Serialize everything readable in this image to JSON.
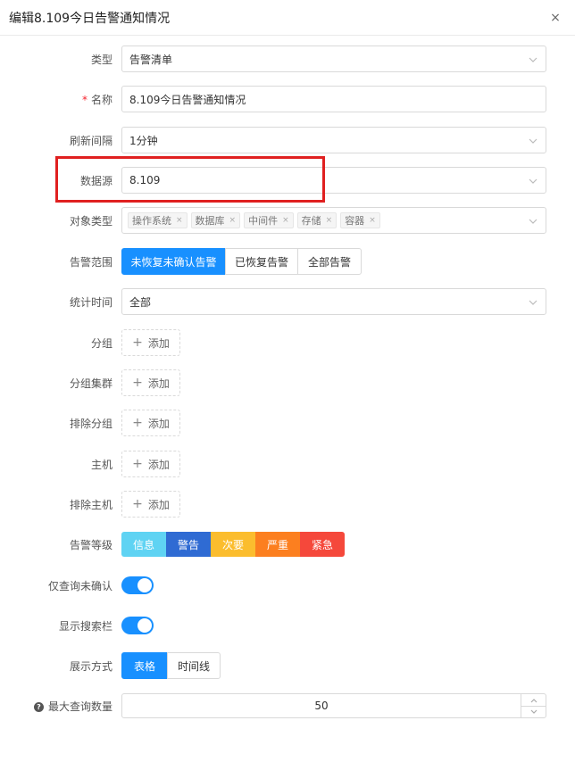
{
  "dialog": {
    "title": "编辑8.109今日告警通知情况",
    "close_label": "×"
  },
  "fields": {
    "type": {
      "label": "类型",
      "value": "告警清单"
    },
    "name": {
      "required_mark": "*",
      "label": "名称",
      "value": "8.109今日告警通知情况"
    },
    "refresh": {
      "label": "刷新间隔",
      "value": "1分钟"
    },
    "datasource": {
      "label": "数据源",
      "value": "8.109"
    },
    "object_type": {
      "label": "对象类型",
      "tags": [
        "操作系统",
        "数据库",
        "中间件",
        "存储",
        "容器"
      ],
      "tag_close": "×"
    },
    "alarm_scope": {
      "label": "告警范围",
      "options": [
        "未恢复未确认告警",
        "已恢复告警",
        "全部告警"
      ],
      "selected": "未恢复未确认告警"
    },
    "stat_time": {
      "label": "统计时间",
      "value": "全部"
    },
    "group": {
      "label": "分组",
      "add_label": "添加",
      "plus": "+"
    },
    "group_cluster": {
      "label": "分组集群",
      "add_label": "添加",
      "plus": "+"
    },
    "exclude_group": {
      "label": "排除分组",
      "add_label": "添加",
      "plus": "+"
    },
    "host": {
      "label": "主机",
      "add_label": "添加",
      "plus": "+"
    },
    "exclude_host": {
      "label": "排除主机",
      "add_label": "添加",
      "plus": "+"
    },
    "alarm_level": {
      "label": "告警等级",
      "levels": [
        {
          "label": "信息",
          "color": "#5fd3f3"
        },
        {
          "label": "警告",
          "color": "#2f6bd3"
        },
        {
          "label": "次要",
          "color": "#fbbd2e"
        },
        {
          "label": "严重",
          "color": "#fc7f1f"
        },
        {
          "label": "紧急",
          "color": "#f5483b"
        }
      ]
    },
    "only_unconfirmed": {
      "label": "仅查询未确认",
      "enabled": true
    },
    "show_search": {
      "label": "显示搜索栏",
      "enabled": true
    },
    "display_mode": {
      "label": "展示方式",
      "options": [
        "表格",
        "时间线"
      ],
      "selected": "表格"
    },
    "max_query": {
      "help": "?",
      "label": "最大查询数量",
      "value": "50"
    }
  },
  "colors": {
    "primary": "#1890ff",
    "highlight": "#e02020"
  },
  "icons": {
    "dropdown": "chevron-down-icon",
    "close": "close-icon"
  }
}
